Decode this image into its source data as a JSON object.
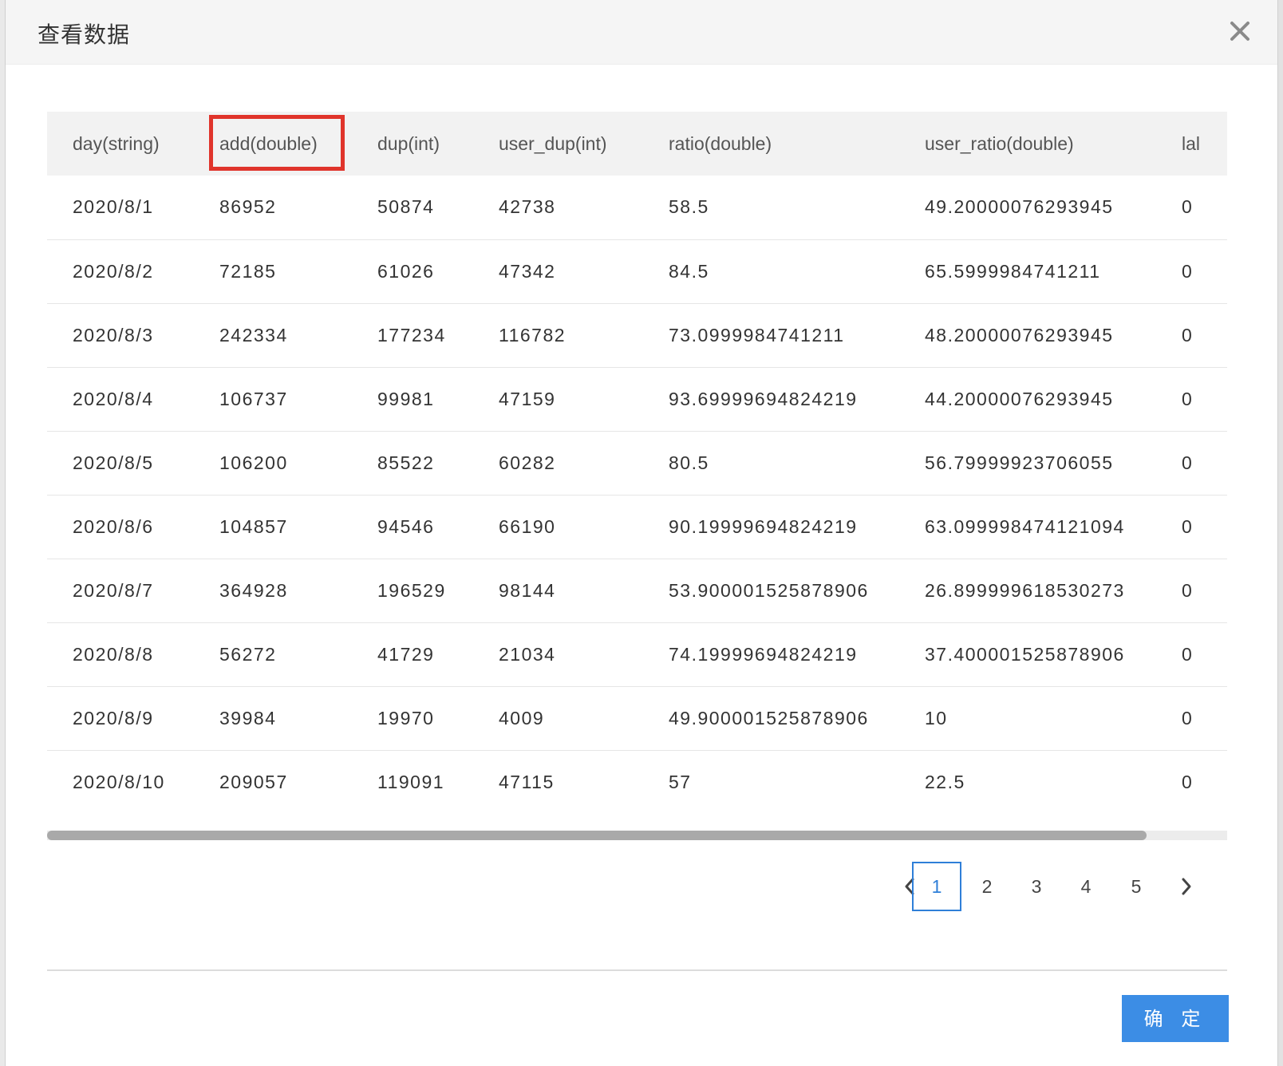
{
  "dialog": {
    "title": "查看数据",
    "ok_label": "确 定"
  },
  "table": {
    "columns": [
      "day(string)",
      "add(double)",
      "dup(int)",
      "user_dup(int)",
      "ratio(double)",
      "user_ratio(double)",
      "lal"
    ],
    "rows": [
      [
        "2020/8/1",
        "86952",
        "50874",
        "42738",
        "58.5",
        "49.20000076293945",
        "0"
      ],
      [
        "2020/8/2",
        "72185",
        "61026",
        "47342",
        "84.5",
        "65.5999984741211",
        "0"
      ],
      [
        "2020/8/3",
        "242334",
        "177234",
        "116782",
        "73.0999984741211",
        "48.20000076293945",
        "0"
      ],
      [
        "2020/8/4",
        "106737",
        "99981",
        "47159",
        "93.69999694824219",
        "44.20000076293945",
        "0"
      ],
      [
        "2020/8/5",
        "106200",
        "85522",
        "60282",
        "80.5",
        "56.79999923706055",
        "0"
      ],
      [
        "2020/8/6",
        "104857",
        "94546",
        "66190",
        "90.19999694824219",
        "63.099998474121094",
        "0"
      ],
      [
        "2020/8/7",
        "364928",
        "196529",
        "98144",
        "53.900001525878906",
        "26.899999618530273",
        "0"
      ],
      [
        "2020/8/8",
        "56272",
        "41729",
        "21034",
        "74.19999694824219",
        "37.400001525878906",
        "0"
      ],
      [
        "2020/8/9",
        "39984",
        "19970",
        "4009",
        "49.900001525878906",
        "10",
        "0"
      ],
      [
        "2020/8/10",
        "209057",
        "119091",
        "47115",
        "57",
        "22.5",
        "0"
      ]
    ],
    "highlighted_column": "add(double)"
  },
  "pagination": {
    "pages": [
      "1",
      "2",
      "3",
      "4",
      "5"
    ],
    "current": "1"
  },
  "colors": {
    "accent": "#3c8de5",
    "active_page": "#2f7fd8",
    "highlight": "#e0342b"
  }
}
